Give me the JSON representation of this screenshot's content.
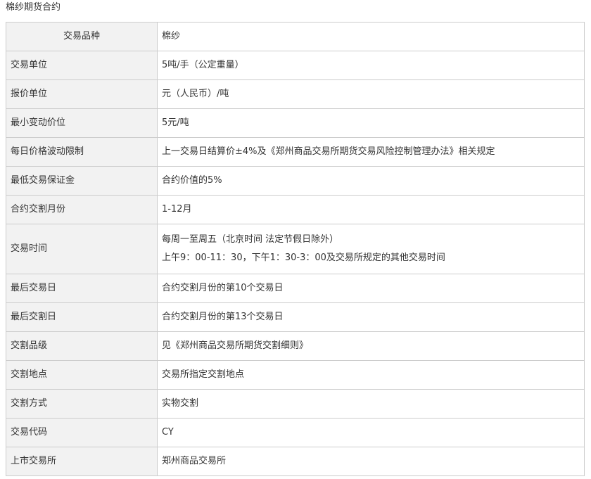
{
  "title": "棉纱期货合约",
  "rows": [
    {
      "key": "交易品种",
      "value": [
        "棉纱"
      ]
    },
    {
      "key": "交易单位",
      "value": [
        "5吨/手（公定重量）"
      ]
    },
    {
      "key": "报价单位",
      "value": [
        "元（人民币）/吨"
      ]
    },
    {
      "key": "最小变动价位",
      "value": [
        "5元/吨"
      ]
    },
    {
      "key": "每日价格波动限制",
      "value": [
        "上一交易日结算价±4%及《郑州商品交易所期货交易风险控制管理办法》相关规定"
      ]
    },
    {
      "key": "最低交易保证金",
      "value": [
        "合约价值的5%"
      ]
    },
    {
      "key": "合约交割月份",
      "value": [
        "1-12月"
      ]
    },
    {
      "key": "交易时间",
      "value": [
        "每周一至周五（北京时间 法定节假日除外）",
        "上午9：00-11：30，下午1：30-3：00及交易所规定的其他交易时间"
      ]
    },
    {
      "key": "最后交易日",
      "value": [
        "合约交割月份的第10个交易日"
      ]
    },
    {
      "key": "最后交割日",
      "value": [
        "合约交割月份的第13个交易日"
      ]
    },
    {
      "key": "交割品级",
      "value": [
        "见《郑州商品交易所期货交割细则》"
      ]
    },
    {
      "key": "交割地点",
      "value": [
        "交易所指定交割地点"
      ]
    },
    {
      "key": "交割方式",
      "value": [
        "实物交割"
      ]
    },
    {
      "key": "交易代码",
      "value": [
        "CY"
      ]
    },
    {
      "key": "上市交易所",
      "value": [
        "郑州商品交易所"
      ]
    }
  ]
}
